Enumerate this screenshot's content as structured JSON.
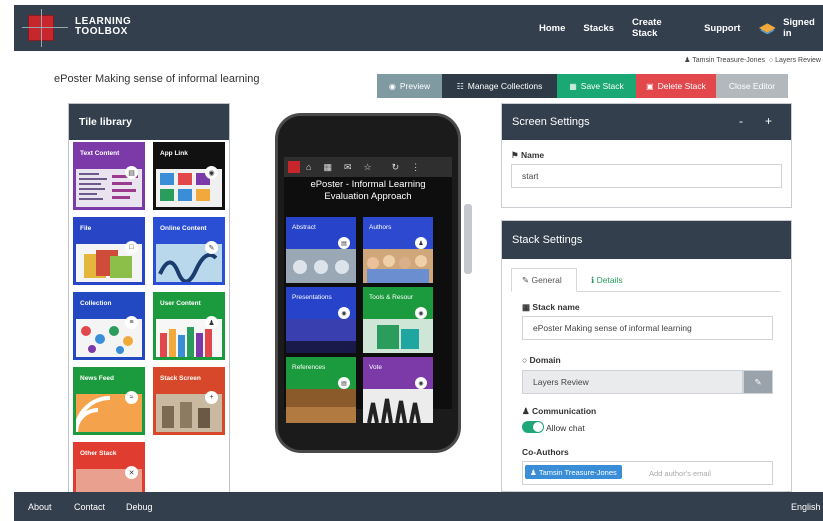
{
  "header": {
    "logo_text_line1": "LEARNING",
    "logo_text_line2": "TOOLBOX",
    "nav": [
      "Home",
      "Stacks",
      "Create Stack",
      "Support"
    ],
    "signed_in": "Signed in"
  },
  "user_line": {
    "user": "Tamsin Treasure-Jones",
    "group": "Layers Review"
  },
  "page_title": "ePoster Making sense of informal learning",
  "toolbar": {
    "preview": "Preview",
    "manage_collections": "Manage Collections",
    "save_stack": "Save Stack",
    "delete_stack": "Delete Stack",
    "close_editor": "Close Editor",
    "colors": {
      "preview": "#7f9aa1",
      "manage": "#2e3a45",
      "save": "#1aa874",
      "delete": "#e2474b",
      "close": "#b3b8bd"
    }
  },
  "tile_library": {
    "title": "Tile library",
    "tiles": [
      {
        "label": "Text Content",
        "color": "#7b3aa8",
        "icon": "document-icon"
      },
      {
        "label": "App Link",
        "color": "#111111",
        "icon": "globe-icon"
      },
      {
        "label": "File",
        "color": "#2845c6",
        "icon": "file-icon"
      },
      {
        "label": "Online Content",
        "color": "#2a4fd4",
        "icon": "edit-icon"
      },
      {
        "label": "Collection",
        "color": "#2248c2",
        "icon": "list-icon"
      },
      {
        "label": "User Content",
        "color": "#1c9a3e",
        "icon": "user-icon"
      },
      {
        "label": "News Feed",
        "color": "#1c9a3e",
        "icon": "rss-icon"
      },
      {
        "label": "Stack Screen",
        "color": "#d7482a",
        "icon": "plus-icon"
      },
      {
        "label": "Other Stack",
        "color": "#e03c2f",
        "icon": "shuffle-icon"
      }
    ]
  },
  "phone": {
    "title_line1": "ePoster - Informal Learning",
    "title_line2": "Evaluation Approach",
    "tiles": [
      {
        "label": "Abstract",
        "color": "#2743c9"
      },
      {
        "label": "Authors",
        "color": "#2d49d0"
      },
      {
        "label": "Presentations",
        "color": "#2743c9"
      },
      {
        "label": "Tools & Resour",
        "color": "#1c9a3e"
      },
      {
        "label": "References",
        "color": "#1c9a3e"
      },
      {
        "label": "Vote",
        "color": "#7b3aa8"
      }
    ]
  },
  "screen_settings": {
    "title": "Screen Settings",
    "minimize": "-",
    "add": "+",
    "name_label": "Name",
    "name_value": "start"
  },
  "stack_settings": {
    "title": "Stack Settings",
    "tab_general": "General",
    "tab_details": "Details",
    "stack_name_label": "Stack name",
    "stack_name_value": "ePoster Making sense of informal learning",
    "domain_label": "Domain",
    "domain_value": "Layers Review",
    "communication_label": "Communication",
    "allow_chat": "Allow chat",
    "allow_chat_on": true,
    "coauthors_label": "Co-Authors",
    "coauthor_chip": "Tamsin Treasure-Jones",
    "add_author_placeholder": "Add author's email"
  },
  "footer": {
    "about": "About",
    "contact": "Contact",
    "debug": "Debug",
    "language": "English"
  }
}
